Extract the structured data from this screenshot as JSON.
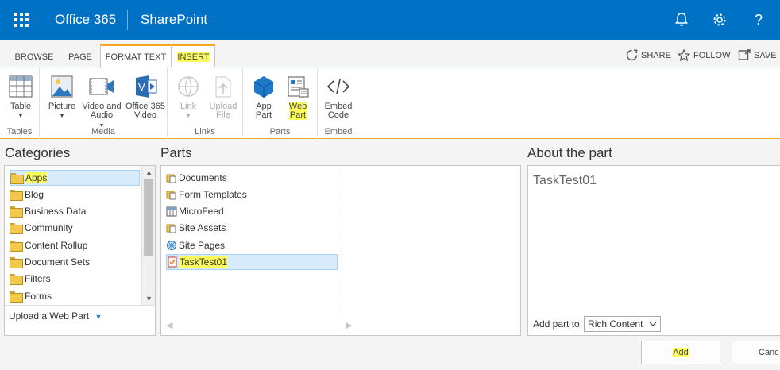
{
  "suite_bar": {
    "brand": "Office 365",
    "app": "SharePoint",
    "icons": [
      "app-launcher-icon",
      "bell-icon",
      "gear-icon",
      "help-icon"
    ],
    "help_glyph": "?"
  },
  "tabs": [
    {
      "label": "BROWSE"
    },
    {
      "label": "PAGE"
    },
    {
      "label": "FORMAT TEXT"
    },
    {
      "label": "INSERT",
      "selected": true,
      "highlighted": true
    }
  ],
  "tab_actions": [
    {
      "label": "SHARE",
      "icon": "share-icon"
    },
    {
      "label": "FOLLOW",
      "icon": "star-icon"
    },
    {
      "label": "SAVE",
      "icon": "save-icon"
    }
  ],
  "ribbon": {
    "groups": [
      {
        "label": "Tables",
        "buttons": [
          {
            "label": "Table",
            "icon": "table-icon",
            "dropdown": true
          }
        ]
      },
      {
        "label": "Media",
        "buttons": [
          {
            "label": "Picture",
            "icon": "picture-icon",
            "dropdown": true
          },
          {
            "label": "Video and\nAudio",
            "icon": "video-icon",
            "dropdown": true
          },
          {
            "label": "Office 365\nVideo",
            "icon": "office365-video-icon"
          }
        ]
      },
      {
        "label": "Links",
        "buttons": [
          {
            "label": "Link",
            "icon": "link-icon",
            "dropdown": true,
            "disabled": true
          },
          {
            "label": "Upload\nFile",
            "icon": "upload-file-icon",
            "disabled": true
          }
        ]
      },
      {
        "label": "Parts",
        "buttons": [
          {
            "label": "App\nPart",
            "icon": "app-part-icon"
          },
          {
            "label": "Web\nPart",
            "icon": "web-part-icon",
            "highlighted": true
          }
        ]
      },
      {
        "label": "Embed",
        "buttons": [
          {
            "label": "Embed\nCode",
            "icon": "embed-code-icon"
          }
        ]
      }
    ]
  },
  "categories": {
    "title": "Categories",
    "items": [
      "Apps",
      "Blog",
      "Business Data",
      "Community",
      "Content Rollup",
      "Document Sets",
      "Filters",
      "Forms"
    ],
    "selected": "Apps",
    "upload_label": "Upload a Web Part"
  },
  "parts": {
    "title": "Parts",
    "items": [
      {
        "label": "Documents",
        "icon": "library-icon"
      },
      {
        "label": "Form Templates",
        "icon": "library-icon"
      },
      {
        "label": "MicroFeed",
        "icon": "list-icon"
      },
      {
        "label": "Site Assets",
        "icon": "library-icon"
      },
      {
        "label": "Site Pages",
        "icon": "wiki-icon"
      },
      {
        "label": "TaskTest01",
        "icon": "task-icon",
        "selected": true,
        "highlighted": true
      }
    ]
  },
  "about": {
    "title": "About the part",
    "part_name": "TaskTest01",
    "add_to_label": "Add part to:",
    "add_to_value": "Rich Content"
  },
  "buttons": {
    "add": "Add",
    "cancel": "Canc"
  },
  "colors": {
    "suite_bar": "#0072c6",
    "accent": "#f5a623",
    "highlight": "#ffff5a",
    "selection": "#d7ebfa"
  }
}
